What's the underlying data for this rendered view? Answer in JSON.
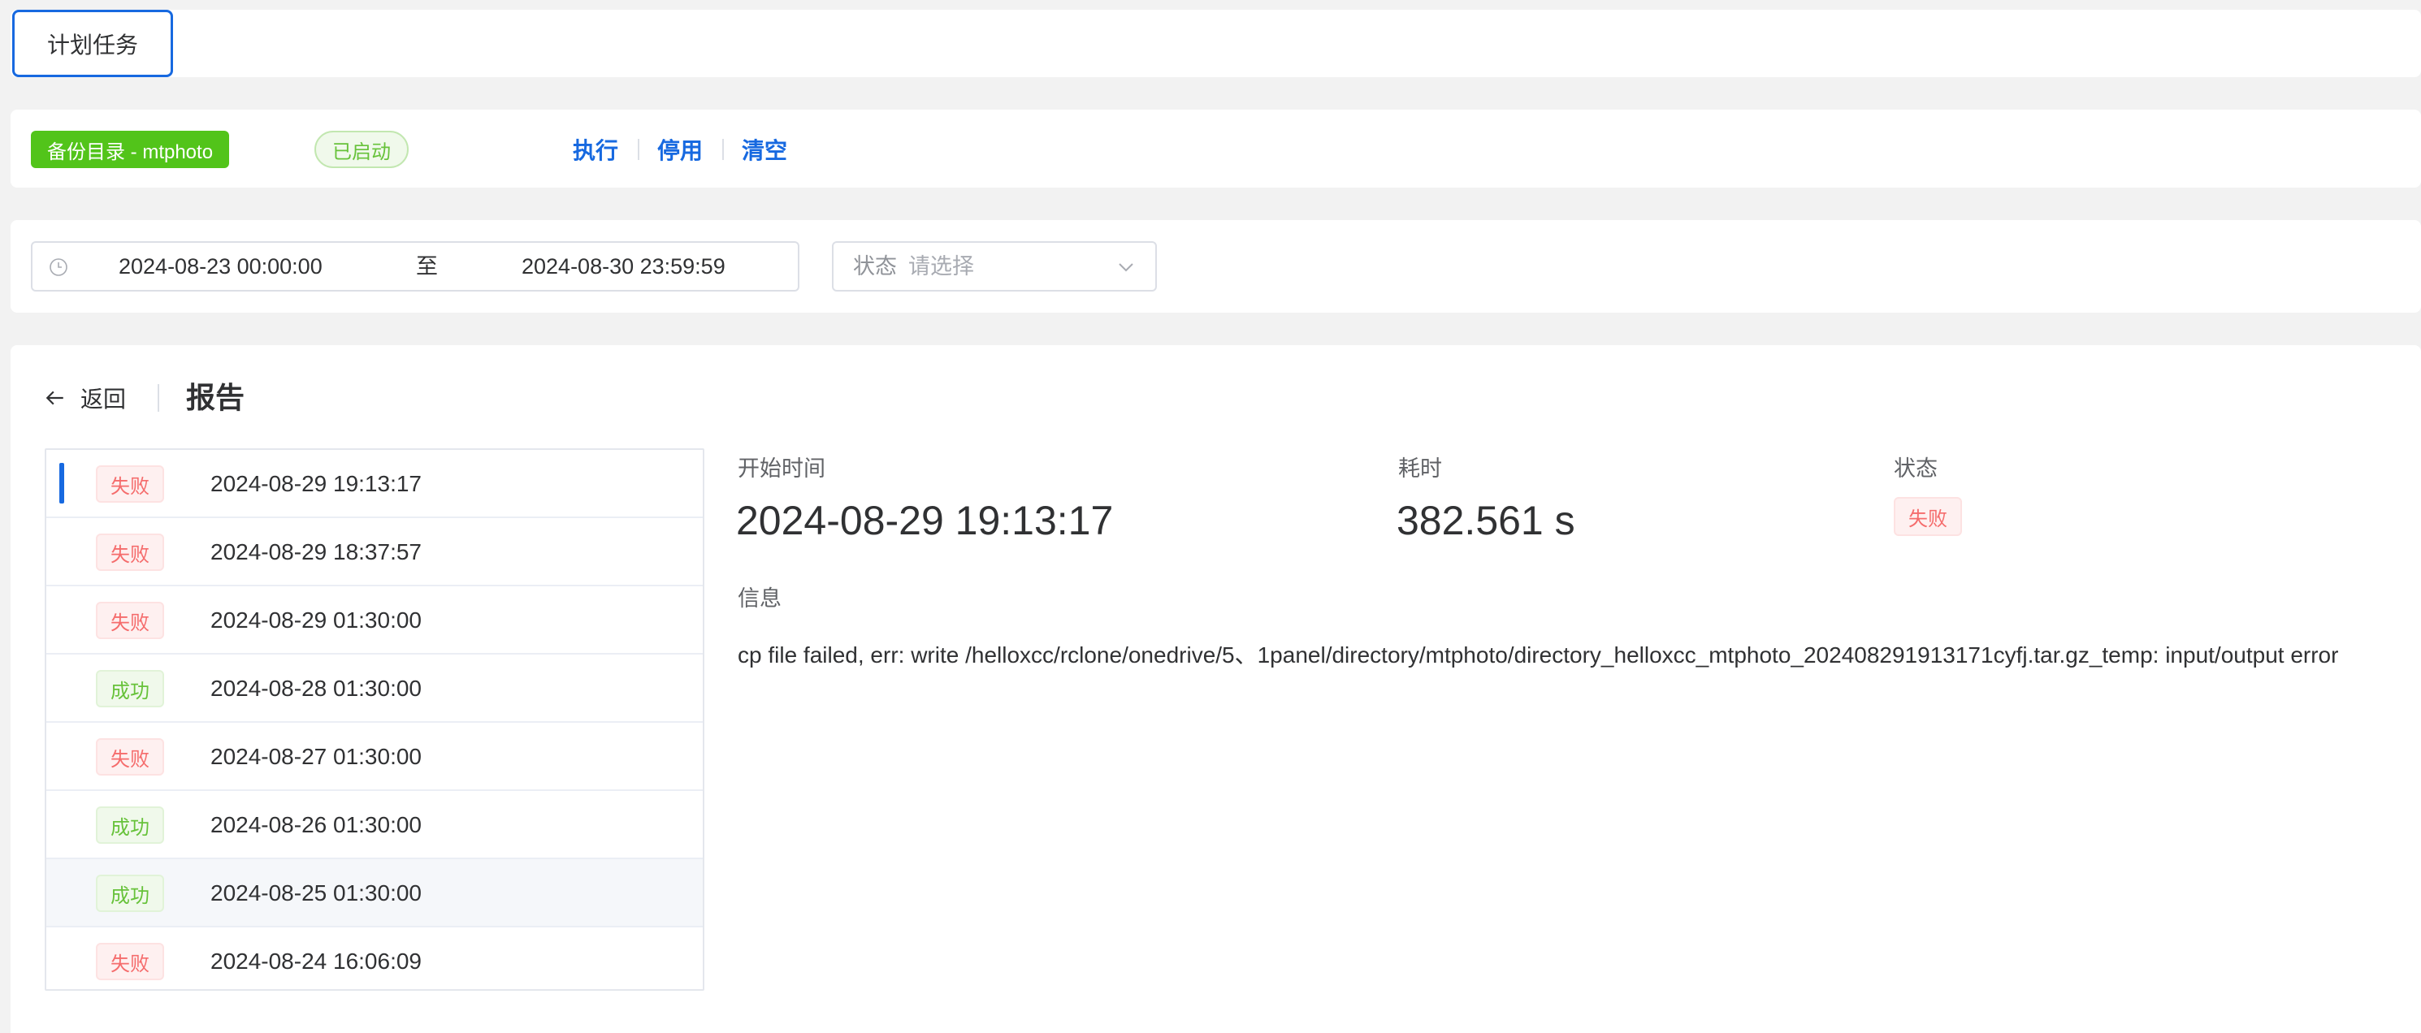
{
  "tabs": [
    {
      "label": "计划任务",
      "active": true
    }
  ],
  "task": {
    "backup_label": "备份目录 - mtphoto",
    "status_label": "已启动",
    "actions": [
      "执行",
      "停用",
      "清空"
    ]
  },
  "filter": {
    "date_start": "2024-08-23 00:00:00",
    "date_separator": "至",
    "date_end": "2024-08-30 23:59:59",
    "status_label": "状态",
    "status_placeholder": "请选择"
  },
  "report": {
    "back_label": "返回",
    "title": "报告",
    "records": [
      {
        "status": "失败",
        "time": "2024-08-29 19:13:17"
      },
      {
        "status": "失败",
        "time": "2024-08-29 18:37:57"
      },
      {
        "status": "失败",
        "time": "2024-08-29 01:30:00"
      },
      {
        "status": "成功",
        "time": "2024-08-28 01:30:00"
      },
      {
        "status": "失败",
        "time": "2024-08-27 01:30:00"
      },
      {
        "status": "成功",
        "time": "2024-08-26 01:30:00"
      },
      {
        "status": "成功",
        "time": "2024-08-25 01:30:00"
      },
      {
        "status": "失败",
        "time": "2024-08-24 16:06:09"
      }
    ],
    "detail": {
      "start_label": "开始时间",
      "start_value": "2024-08-29 19:13:17",
      "duration_label": "耗时",
      "duration_value": "382.561 s",
      "status_label": "状态",
      "status_value": "失败",
      "info_label": "信息",
      "message": "cp file failed, err: write /helloxcc/rclone/onedrive/5、1panel/directory/mtphoto/directory_helloxcc_mtphoto_20240829191317​1cyfj.tar.gz_temp: input/output error"
    }
  },
  "colors": {
    "primary": "#1769e0",
    "success": "#52c41a",
    "danger": "#f56c6c",
    "page_bg": "#f2f2f2"
  }
}
